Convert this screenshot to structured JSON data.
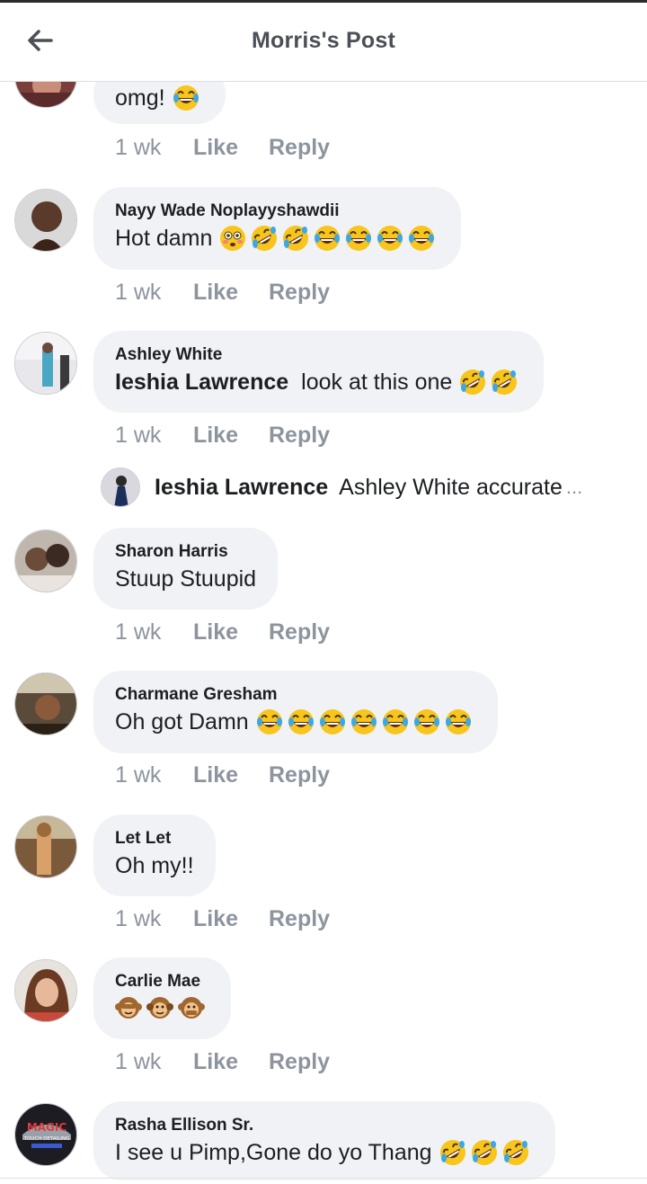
{
  "header": {
    "title": "Morris's Post"
  },
  "comments": [
    {
      "name": "",
      "text": "omg!",
      "emojis": [
        "laugh"
      ],
      "time": "1 wk",
      "like": "Like",
      "reply": "Reply"
    },
    {
      "name": "Nayy Wade Noplayyshawdii",
      "text": "Hot damn",
      "emojis": [
        "flushed",
        "rofl",
        "rofl",
        "laugh",
        "laugh",
        "laugh",
        "laugh"
      ],
      "time": "1 wk",
      "like": "Like",
      "reply": "Reply"
    },
    {
      "name": "Ashley White",
      "mention": "Ieshia Lawrence",
      "text": "look at this one",
      "emojis": [
        "rofl",
        "rofl"
      ],
      "time": "1 wk",
      "like": "Like",
      "reply": "Reply"
    },
    {
      "name": "Sharon Harris",
      "text": "Stuup Stuupid",
      "emojis": [],
      "time": "1 wk",
      "like": "Like",
      "reply": "Reply"
    },
    {
      "name": "Charmane Gresham",
      "text": "Oh got Damn",
      "emojis": [
        "laugh",
        "laugh",
        "laugh",
        "laugh",
        "laugh",
        "laugh",
        "laugh"
      ],
      "time": "1 wk",
      "like": "Like",
      "reply": "Reply"
    },
    {
      "name": "Let Let",
      "text": "Oh my!!",
      "emojis": [],
      "time": "1 wk",
      "like": "Like",
      "reply": "Reply"
    },
    {
      "name": "Carlie Mae",
      "text": "",
      "emojis": [
        "see-no-evil-monkey",
        "hear-no-evil-monkey",
        "speak-no-evil-monkey"
      ],
      "time": "1 wk",
      "like": "Like",
      "reply": "Reply"
    },
    {
      "name": "Rasha Ellison Sr.",
      "text": "I see u Pimp,Gone do yo Thang",
      "emojis": [
        "rofl",
        "rofl",
        "rofl"
      ]
    }
  ],
  "reply_preview": {
    "name": "Ieshia Lawrence",
    "text": "Ashley White accurate",
    "more": "..."
  },
  "avatar_logo": {
    "line1": "MAGIC",
    "line2": "TOUCH DETAILING"
  },
  "colors": {
    "bubble": "#f0f2f5",
    "meta": "#8d949e",
    "emoji_face": "#f7c51b",
    "emoji_tear": "#3da7e6"
  }
}
